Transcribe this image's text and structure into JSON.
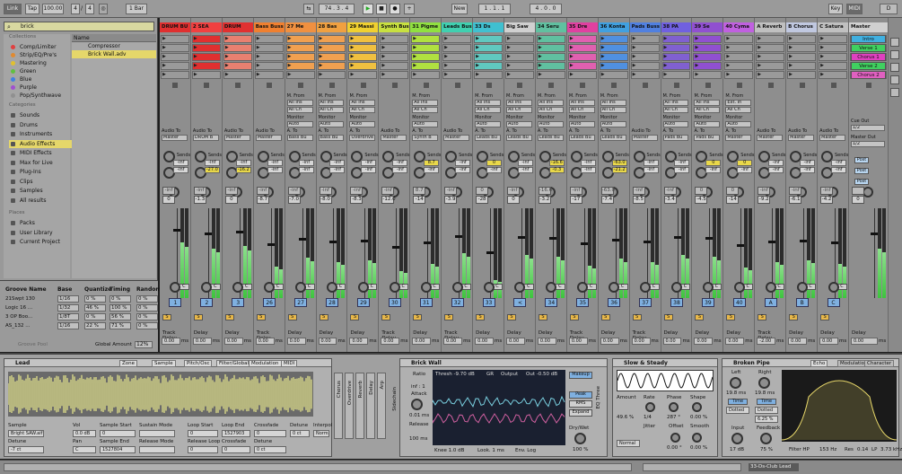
{
  "transport": {
    "link": "Link",
    "tap": "Tap",
    "tempo": "100.00",
    "sig_num": "4",
    "sig_den": "4",
    "quant": "1 Bar",
    "pos": "74 . 3 . 4",
    "new": "New",
    "loop_start": "1 . 1 . 1",
    "loop_len": "4 . 0 . 0",
    "key": "Key",
    "midi": "MIDI",
    "cpu": "D"
  },
  "browser": {
    "search": "brick",
    "col_header": "Name",
    "collections": [
      {
        "label": "Comp/Limiter",
        "color": "#e04040"
      },
      {
        "label": "Strip/EQ/Pre's",
        "color": "#e08a30"
      },
      {
        "label": "Mastering",
        "color": "#e0c030"
      },
      {
        "label": "Green",
        "color": "#60c040"
      },
      {
        "label": "Blue",
        "color": "#4080e0"
      },
      {
        "label": "Purple",
        "color": "#a050d0"
      },
      {
        "label": "Pop/Synthwave",
        "color": "#909090"
      }
    ],
    "categories_h": "Categories",
    "categories": [
      "Sounds",
      "Drums",
      "Instruments",
      "Audio Effects",
      "MIDI Effects",
      "Max for Live",
      "Plug-Ins",
      "Clips",
      "Samples",
      "All results"
    ],
    "places_h": "Places",
    "places": [
      "Packs",
      "User Library",
      "Current Project"
    ],
    "files": [
      "Compressor",
      "Brick Wall.adv"
    ]
  },
  "groove": {
    "headers": [
      "Groove Name",
      "Base",
      "Quantize",
      "Timing",
      "Random"
    ],
    "rows": [
      [
        "21Swpt 130",
        "1/16",
        "0 %",
        "0 %",
        "0 %"
      ],
      [
        "Logic 16 ...",
        "1/32",
        "46 %",
        "100 %",
        "0 %"
      ],
      [
        "3 OP Boo...",
        "1/8T",
        "0 %",
        "56 %",
        "0 %"
      ],
      [
        "AS_132 ...",
        "1/16",
        "22 %",
        "71 %",
        "0 %"
      ]
    ],
    "global_label": "Global Amount",
    "global_value": "12%",
    "placeholder": "Groove Pool"
  },
  "mixer": {
    "channels": [
      {
        "name": "DRUM BU",
        "color": "#e03030",
        "vol": "0",
        "send_a": "-inf",
        "send_b": "-inf",
        "num": "1",
        "level": 0.62,
        "clip": "",
        "delay": "0.00",
        "in": "",
        "mon": "",
        "out": "Master"
      },
      {
        "name": "2 SEA",
        "color": "#f04040",
        "vol": "-1.3",
        "send_a": "-inf",
        "send_b": "-27.0",
        "num": "2",
        "level": 0.55,
        "clip": "#e03030",
        "delay": "0.00",
        "in": "",
        "mon": "",
        "out": "DRUM B"
      },
      {
        "name": "DRUM",
        "color": "#e03030",
        "vol": "0",
        "send_a": "-inf",
        "send_b": "-16.2",
        "num": "3",
        "level": 0.58,
        "clip": "#e88070",
        "delay": "0.00",
        "in": "",
        "mon": "",
        "out": "Master"
      },
      {
        "name": "Bass Buss",
        "color": "#f08030",
        "vol": "-8.7",
        "send_a": "-inf",
        "send_b": "-inf",
        "num": "26",
        "level": 0.35,
        "clip": "",
        "delay": "0.00",
        "in": "",
        "mon": "",
        "out": "Master"
      },
      {
        "name": "27 Me",
        "color": "#f09040",
        "vol": "-7.0",
        "send_a": "-inf",
        "send_b": "-inf",
        "num": "27",
        "level": 0.45,
        "clip": "#f0a050",
        "delay": "0.00",
        "in": "All Ins",
        "mon": "Auto",
        "out": "Bass Bu"
      },
      {
        "name": "28 Bas",
        "color": "#f0a040",
        "vol": "-8.0",
        "send_a": "-inf",
        "send_b": "-inf",
        "num": "28",
        "level": 0.4,
        "clip": "#f0a050",
        "delay": "0.00",
        "in": "All Ins",
        "mon": "Auto",
        "out": "Bass Bu"
      },
      {
        "name": "29 Massi",
        "color": "#f0d030",
        "vol": "-8.3",
        "send_a": "-inf",
        "send_b": "-inf",
        "num": "29",
        "level": 0.42,
        "clip": "#f0c040",
        "delay": "0.00",
        "in": "All Ins",
        "mon": "Auto",
        "out": "Overdrive"
      },
      {
        "name": "Synth Buss",
        "color": "#c8e040",
        "vol": "-12.0",
        "send_a": "-inf",
        "send_b": "-inf",
        "num": "30",
        "level": 0.3,
        "clip": "",
        "delay": "0.00",
        "in": "",
        "mon": "",
        "out": "Master"
      },
      {
        "name": "31 Pigme",
        "color": "#90e040",
        "vol": "-14",
        "send_a": "8.7",
        "send_b": "-inf",
        "num": "31",
        "level": 0.38,
        "clip": "#b0e040",
        "delay": "0.00",
        "in": "All Ins",
        "mon": "Auto",
        "out": "Synth B"
      },
      {
        "name": "Leads Buss",
        "color": "#40d0b0",
        "vol": "-3.9",
        "send_a": "-inf",
        "send_b": "-inf",
        "num": "32",
        "level": 0.5,
        "clip": "",
        "delay": "0.00",
        "in": "",
        "mon": "",
        "out": "Master"
      },
      {
        "name": "33 Ds",
        "color": "#40c0d0",
        "vol": "-28",
        "send_a": "0",
        "send_b": "-inf",
        "num": "33",
        "level": 0.2,
        "clip": "#60c8c0",
        "delay": "0.00",
        "in": "All Ins",
        "mon": "Auto",
        "out": "Leads Bu"
      },
      {
        "name": "Big Saw",
        "color": "#d0d0d0",
        "vol": "0",
        "send_a": "-inf",
        "send_b": "-inf",
        "num": "<",
        "level": 0.48,
        "clip": "",
        "delay": "0.00",
        "in": "All Ins",
        "mon": "Auto",
        "out": "Leads Bu"
      },
      {
        "name": "34 Seru",
        "color": "#60c0a0",
        "vol": "-3.2",
        "send_a": "-16.6",
        "send_b": "-0.3",
        "num": "34",
        "level": 0.46,
        "clip": "#60c0a0",
        "delay": "0.00",
        "in": "All Ins",
        "mon": "Auto",
        "out": "Leads Bu"
      },
      {
        "name": "35 Dre",
        "color": "#e040a0",
        "vol": "-17",
        "send_a": "-inf",
        "send_b": "-inf",
        "num": "35",
        "level": 0.36,
        "clip": "#e060b0",
        "delay": "0.00",
        "in": "All Ins",
        "mon": "Auto",
        "out": "Leads Bu"
      },
      {
        "name": "36 Konta",
        "color": "#40a0e0",
        "vol": "-7.4",
        "send_a": "-63.0",
        "send_b": "-21.2",
        "num": "36",
        "level": 0.44,
        "clip": "#5090e0",
        "delay": "0.00",
        "in": "All Ins",
        "mon": "Auto",
        "out": "Leads Bu"
      },
      {
        "name": "Pads Buss",
        "color": "#5080e0",
        "vol": "-8.5",
        "send_a": "-inf",
        "send_b": "-inf",
        "num": "37",
        "level": 0.4,
        "clip": "",
        "delay": "0.00",
        "in": "",
        "mon": "",
        "out": "Master"
      },
      {
        "name": "38 PA",
        "color": "#7060e0",
        "vol": "-3.4",
        "send_a": "-inf",
        "send_b": "-inf",
        "num": "38",
        "level": 0.48,
        "clip": "#8060d0",
        "delay": "0.00",
        "in": "All Ins",
        "mon": "Auto",
        "out": "Pads Bu"
      },
      {
        "name": "39 Se",
        "color": "#9050d0",
        "vol": "-4.5",
        "send_a": "0",
        "send_b": "-inf",
        "num": "39",
        "level": 0.46,
        "clip": "#9050d0",
        "delay": "0.00",
        "in": "All Ins",
        "mon": "Auto",
        "out": "Pads Bu"
      },
      {
        "name": "40 Cyma",
        "color": "#c060e0",
        "vol": "-14",
        "send_a": "0",
        "send_b": "-inf",
        "num": "40",
        "level": 0.34,
        "clip": "",
        "delay": "0.00",
        "in": "Ext. In",
        "mon": "Auto",
        "out": "Master"
      },
      {
        "name": "A Reverb",
        "color": "#c0c0c0",
        "vol": "-9.2",
        "send_a": "-inf",
        "send_b": "-inf",
        "num": "A",
        "level": 0.4,
        "clip": "",
        "delay": "-2.00",
        "in": "",
        "mon": "",
        "out": "Master"
      },
      {
        "name": "B Chorus",
        "color": "#c0c8e0",
        "vol": "-6.1",
        "send_a": "-inf",
        "send_b": "-inf",
        "num": "B",
        "level": 0.42,
        "clip": "",
        "delay": "0.00",
        "in": "",
        "mon": "",
        "out": "Master"
      },
      {
        "name": "C Satura",
        "color": "#c0c0c0",
        "vol": "-4.2",
        "send_a": "-inf",
        "send_b": "-inf",
        "num": "C",
        "level": 0.38,
        "clip": "",
        "delay": "0.00",
        "in": "",
        "mon": "",
        "out": "Master"
      },
      {
        "name": "Master",
        "color": "#d0d0d0",
        "vol": "0",
        "send_a": "",
        "send_b": "",
        "num": "",
        "level": 0.55,
        "clip": "",
        "delay": "0.00",
        "in": "",
        "mon": "",
        "out": ""
      }
    ],
    "scenes": [
      {
        "label": "Intro",
        "color": "#40b0e0"
      },
      {
        "label": "Verse 1",
        "color": "#40d060"
      },
      {
        "label": "Chorus 1",
        "color": "#e040c0"
      },
      {
        "label": "Verse 2",
        "color": "#40d060"
      },
      {
        "label": "Chorus 2",
        "color": "#e060c0"
      }
    ],
    "labels": {
      "midi_from": "M. From",
      "all_ins": "All Ins",
      "all_ch": "All Ch",
      "monitor": "Monitor",
      "audio_to": "Audio To",
      "a_to": "A. To",
      "sends": "Sends",
      "track_delay": "Track Delay",
      "delay": "Delay",
      "ms": "ms",
      "cue_out": "Cue Out",
      "cue_val": "1/2",
      "master_out": "Master Out",
      "master_val": "1/2",
      "post": "Post",
      "solo": "S",
      "c": "C"
    }
  },
  "detail": {
    "simpler": {
      "title": "Lead",
      "tabs": [
        "Zone",
        "Sample",
        "Pitch/Osc",
        "Filter/Global",
        "Modulation",
        "MIDI"
      ],
      "fields": [
        {
          "k": "Sample",
          "v": "Bright SAW.aif"
        },
        {
          "k": "Vol",
          "v": "0.0 dB"
        },
        {
          "k": "Sample Start",
          "v": "0"
        },
        {
          "k": "Sustain Mode",
          "v": ""
        },
        {
          "k": "Loop Start",
          "v": "0"
        },
        {
          "k": "Loop End",
          "v": "1527903"
        },
        {
          "k": "Crossfade",
          "v": "0"
        },
        {
          "k": "Detune",
          "v": "0 ct"
        },
        {
          "k": "Interpol",
          "v": "Norm"
        }
      ],
      "row2": [
        {
          "k": "Detune",
          "v": "-7 ct"
        },
        {
          "k": "Pan",
          "v": "C"
        },
        {
          "k": "Sample End",
          "v": "1527804"
        },
        {
          "k": "Release Mode",
          "v": ""
        },
        {
          "k": "Release Loop",
          "v": "0"
        },
        {
          "k": "Crossfade",
          "v": "0"
        },
        {
          "k": "Detune",
          "v": "0 ct"
        }
      ],
      "side": [
        "Chorus",
        "Overdrive",
        "Reverb",
        "Delay",
        "Arp"
      ]
    },
    "brickwall": {
      "title": "Brick Wall",
      "thresh": "Thresh -9.70 dB",
      "gr": "GR",
      "output": "Output",
      "out": "Out -0.50 dB",
      "ratio": "Ratio",
      "ratio_v": "inf : 1",
      "attack": "Attack",
      "attack_v": "0.01 ms",
      "release": "Release",
      "release_v": "100 ms",
      "makeup": "Makeup",
      "peak": "Peak",
      "rms": "RMS",
      "expand": "Expand",
      "knee": "Knee 1.0 dB",
      "look": "Look. 1 ms",
      "env": "Env. Log",
      "drywet": "Dry/Wet",
      "drywet_v": "100 %",
      "side": "Sidechain"
    },
    "lfo": {
      "title": "Slow & Steady",
      "amount": "Amount",
      "amount_v": "49.6 %",
      "rate": "Rate",
      "rate_v": "1/4",
      "phase": "Phase",
      "phase_v": "287 °",
      "shape": "Shape",
      "shape_v": "0.00 %",
      "jitter": "Jitter",
      "jitter_v": "",
      "offset": "Offset",
      "offset_v": "0.00 °",
      "smooth": "Smooth",
      "smooth_v": "0.00 %",
      "normal": "Normal",
      "eq": "EQ Three"
    },
    "pipe": {
      "title": "Broken Pipe",
      "left": "Left",
      "left_v": "19.8 ms",
      "right": "Right",
      "right_v": "19.8 ms",
      "time": "Time",
      "dotted": "Dotted",
      "sync": "6.25 %",
      "input": "Input",
      "input_v": "17 dB",
      "feedback": "Feedback",
      "feedback_v": "75 %"
    },
    "echo": {
      "tabs": [
        "Echo",
        "Modulation",
        "Character"
      ],
      "filter": "Filter HP",
      "filter_v": "153 Hz",
      "res": "Res",
      "res_v": "0.14",
      "lp": "LP",
      "lp_v": "3.73 kHz"
    }
  },
  "status": {
    "track": "33-Ds-Club Lead"
  }
}
